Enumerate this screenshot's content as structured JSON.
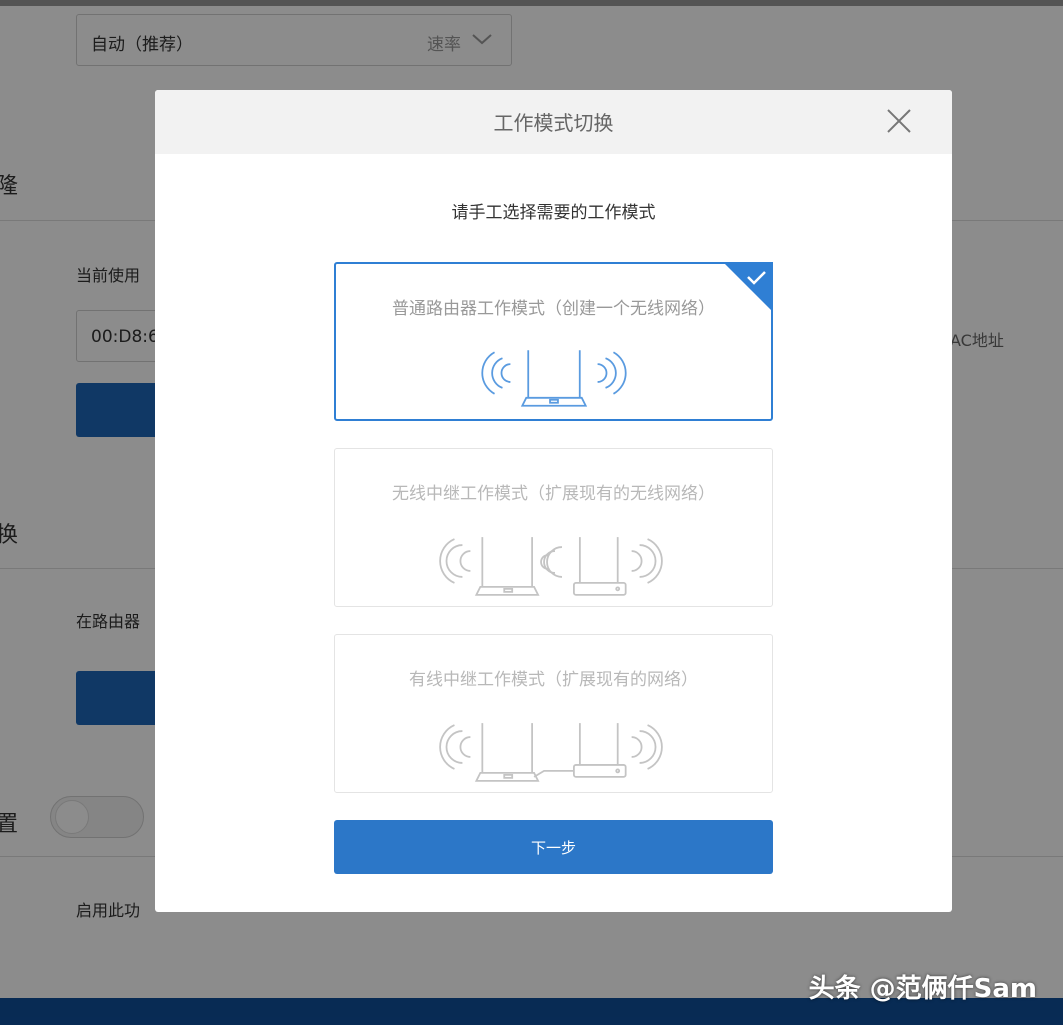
{
  "background": {
    "rate_select": {
      "value": "自动（推荐）",
      "right_label": "速率"
    },
    "section_titles": [
      "隆",
      "换",
      "置"
    ],
    "current_mac_label": "当前使用",
    "mac_value": "00:D8:6",
    "mac_right_label": "AC地址",
    "router_text": "在路由器",
    "enable_text": "启用此功"
  },
  "modal": {
    "title": "工作模式切换",
    "subtitle": "请手工选择需要的工作模式",
    "options": [
      {
        "label": "普通路由器工作模式（创建一个无线网络）",
        "selected": true
      },
      {
        "label": "无线中继工作模式（扩展现有的无线网络）",
        "selected": false
      },
      {
        "label": "有线中继工作模式（扩展现有的网络）",
        "selected": false
      }
    ],
    "next_label": "下一步"
  },
  "watermark": "头条 @范俩仟Sam",
  "colors": {
    "primary": "#2c77c8",
    "selected_border": "#2f7fd4",
    "footer": "#0f4f9a",
    "background_button": "#1e67b8"
  },
  "icons": [
    "chevron-down-icon",
    "close-icon",
    "check-icon",
    "router-icon",
    "wifi-signal-icon"
  ]
}
